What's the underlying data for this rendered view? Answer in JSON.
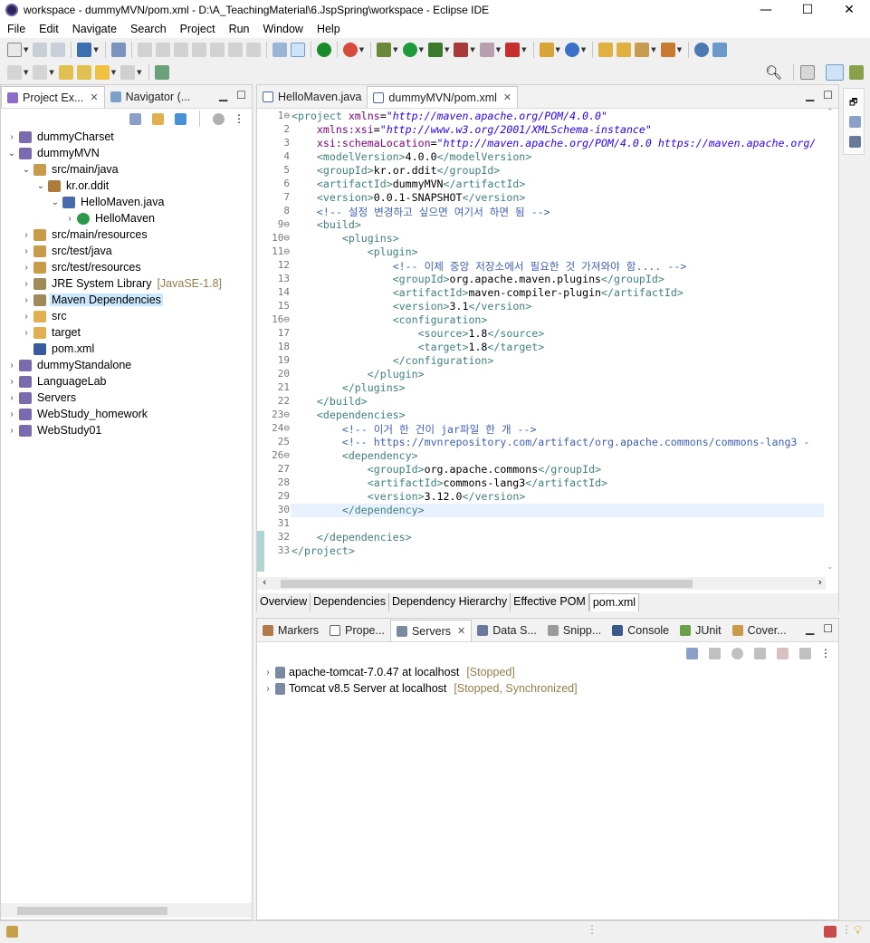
{
  "window": {
    "title": "workspace - dummyMVN/pom.xml - D:\\A_TeachingMaterial\\6.JspSpring\\workspace - Eclipse IDE"
  },
  "menu": [
    "File",
    "Edit",
    "Navigate",
    "Search",
    "Project",
    "Run",
    "Window",
    "Help"
  ],
  "left": {
    "tabs": [
      {
        "label": "Project Ex..."
      },
      {
        "label": "Navigator (..."
      }
    ],
    "tree": [
      {
        "label": "dummyCharset",
        "indent": 0,
        "arrow": "›",
        "icon": "project-icon"
      },
      {
        "label": "dummyMVN",
        "indent": 0,
        "arrow": "⌄",
        "icon": "project-icon"
      },
      {
        "label": "src/main/java",
        "indent": 1,
        "arrow": "⌄",
        "icon": "source-folder-icon"
      },
      {
        "label": "kr.or.ddit",
        "indent": 2,
        "arrow": "⌄",
        "icon": "package-icon"
      },
      {
        "label": "HelloMaven.java",
        "indent": 3,
        "arrow": "⌄",
        "icon": "java-file-icon"
      },
      {
        "label": "HelloMaven",
        "indent": 4,
        "arrow": "›",
        "icon": "class-icon"
      },
      {
        "label": "src/main/resources",
        "indent": 1,
        "arrow": "›",
        "icon": "source-folder-icon"
      },
      {
        "label": "src/test/java",
        "indent": 1,
        "arrow": "›",
        "icon": "source-folder-icon"
      },
      {
        "label": "src/test/resources",
        "indent": 1,
        "arrow": "›",
        "icon": "source-folder-icon"
      },
      {
        "label": "JRE System Library",
        "deco": "[JavaSE-1.8]",
        "indent": 1,
        "arrow": "›",
        "icon": "library-icon"
      },
      {
        "label": "Maven Dependencies",
        "indent": 1,
        "arrow": "›",
        "icon": "library-icon",
        "selected": true
      },
      {
        "label": "src",
        "indent": 1,
        "arrow": "›",
        "icon": "folder-icon"
      },
      {
        "label": "target",
        "indent": 1,
        "arrow": "›",
        "icon": "folder-icon"
      },
      {
        "label": "pom.xml",
        "indent": 1,
        "arrow": "",
        "icon": "maven-file-icon"
      },
      {
        "label": "dummyStandalone",
        "indent": 0,
        "arrow": "›",
        "icon": "project-icon"
      },
      {
        "label": "LanguageLab",
        "indent": 0,
        "arrow": "›",
        "icon": "project-icon"
      },
      {
        "label": "Servers",
        "indent": 0,
        "arrow": "›",
        "icon": "project-icon"
      },
      {
        "label": "WebStudy_homework",
        "indent": 0,
        "arrow": "›",
        "icon": "project-icon"
      },
      {
        "label": "WebStudy01",
        "indent": 0,
        "arrow": "›",
        "icon": "project-icon"
      }
    ]
  },
  "editor": {
    "tabs": [
      {
        "label": "HelloMaven.java"
      },
      {
        "label": "dummyMVN/pom.xml"
      }
    ],
    "lines": [
      {
        "n": "1⊖",
        "c": "<project xmlns=\"http://maven.apache.org/POM/4.0.0\""
      },
      {
        "n": "2",
        "c": "    xmlns:xsi=\"http://www.w3.org/2001/XMLSchema-instance\""
      },
      {
        "n": "3",
        "c": "    xsi:schemaLocation=\"http://maven.apache.org/POM/4.0.0 https://maven.apache.org/"
      },
      {
        "n": "4",
        "c": "    <modelVersion>4.0.0</modelVersion>"
      },
      {
        "n": "5",
        "c": "    <groupId>kr.or.ddit</groupId>"
      },
      {
        "n": "6",
        "c": "    <artifactId>dummyMVN</artifactId>"
      },
      {
        "n": "7",
        "c": "    <version>0.0.1-SNAPSHOT</version>"
      },
      {
        "n": "8",
        "c": "    <!-- 설정 변경하고 싶으면 여기서 하면 됨 -->"
      },
      {
        "n": "9⊖",
        "c": "    <build>"
      },
      {
        "n": "10⊖",
        "c": "        <plugins>"
      },
      {
        "n": "11⊖",
        "c": "            <plugin>"
      },
      {
        "n": "12",
        "c": "                <!-- 이제 중앙 저장소에서 필요한 것 가져와야 함.... -->"
      },
      {
        "n": "13",
        "c": "                <groupId>org.apache.maven.plugins</groupId>"
      },
      {
        "n": "14",
        "c": "                <artifactId>maven-compiler-plugin</artifactId>"
      },
      {
        "n": "15",
        "c": "                <version>3.1</version>"
      },
      {
        "n": "16⊖",
        "c": "                <configuration>"
      },
      {
        "n": "17",
        "c": "                    <source>1.8</source>"
      },
      {
        "n": "18",
        "c": "                    <target>1.8</target>"
      },
      {
        "n": "19",
        "c": "                </configuration>"
      },
      {
        "n": "20",
        "c": "            </plugin>"
      },
      {
        "n": "21",
        "c": "        </plugins>"
      },
      {
        "n": "22",
        "c": "    </build>"
      },
      {
        "n": "23⊖",
        "c": "    <dependencies>"
      },
      {
        "n": "24⊖",
        "c": "        <!-- 이거 한 건이 jar파일 한 개 -->"
      },
      {
        "n": "25",
        "c": "        <!-- https://mvnrepository.com/artifact/org.apache.commons/commons-lang3 -"
      },
      {
        "n": "26⊖",
        "c": "        <dependency>"
      },
      {
        "n": "27",
        "c": "            <groupId>org.apache.commons</groupId>"
      },
      {
        "n": "28",
        "c": "            <artifactId>commons-lang3</artifactId>"
      },
      {
        "n": "29",
        "c": "            <version>3.12.0</version>"
      },
      {
        "n": "30",
        "c": "        </dependency>"
      },
      {
        "n": "31",
        "c": ""
      },
      {
        "n": "32",
        "c": "    </dependencies>"
      },
      {
        "n": "33",
        "c": "</project>"
      }
    ],
    "bottom_tabs": [
      "Overview",
      "Dependencies",
      "Dependency Hierarchy",
      "Effective POM",
      "pom.xml"
    ]
  },
  "bottom": {
    "tabs": [
      {
        "label": "Markers"
      },
      {
        "label": "Prope..."
      },
      {
        "label": "Servers"
      },
      {
        "label": "Data S..."
      },
      {
        "label": "Snipp..."
      },
      {
        "label": "Console"
      },
      {
        "label": "JUnit"
      },
      {
        "label": "Cover..."
      }
    ],
    "servers": [
      {
        "name": "apache-tomcat-7.0.47 at localhost",
        "status": "[Stopped]"
      },
      {
        "name": "Tomcat v8.5 Server at localhost",
        "status": "[Stopped, Synchronized]"
      }
    ]
  },
  "colors": {
    "selection": "#cce8ff",
    "tag": "#3f7f7f",
    "attr": "#7f007f",
    "value": "#2a00ff",
    "comment": "#3f5fbf"
  }
}
